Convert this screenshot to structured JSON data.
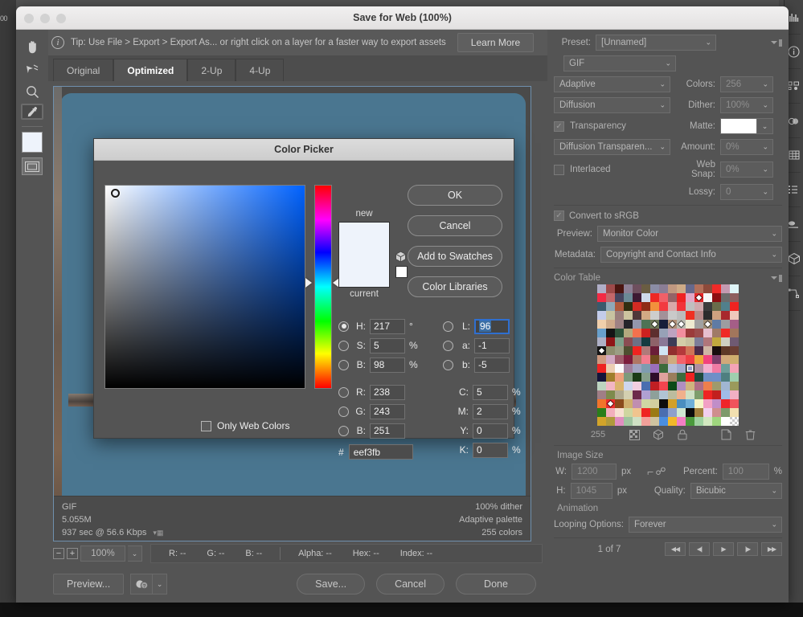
{
  "window": {
    "title": "Save for Web (100%)"
  },
  "tip": {
    "icon": "info-icon",
    "text": "Tip: Use File > Export > Export As...  or right click on a layer for a faster way to export assets",
    "button": "Learn More"
  },
  "tools": [
    {
      "name": "hand-tool",
      "glyph": "✋"
    },
    {
      "name": "slice-select-tool",
      "glyph": "➤"
    },
    {
      "name": "zoom-tool",
      "glyph": "🔍"
    },
    {
      "name": "eyedropper-tool",
      "glyph": "💧"
    }
  ],
  "tabs": [
    {
      "label": "Original",
      "active": false
    },
    {
      "label": "Optimized",
      "active": true
    },
    {
      "label": "2-Up",
      "active": false
    },
    {
      "label": "4-Up",
      "active": false
    }
  ],
  "preview_info": {
    "format": "GIF",
    "size": "5.055M",
    "speed": "937 sec @ 56.6 Kbps",
    "dither": "100% dither",
    "palette": "Adaptive palette",
    "colors": "255 colors"
  },
  "statusbar": {
    "zoom": "100%",
    "r": "R: --",
    "g": "G: --",
    "b": "B: --",
    "alpha": "Alpha: --",
    "hex": "Hex: --",
    "index": "Index: --"
  },
  "actions": {
    "preview": "Preview...",
    "save": "Save...",
    "cancel": "Cancel",
    "done": "Done"
  },
  "settings": {
    "preset_label": "Preset:",
    "preset_value": "[Unnamed]",
    "format_value": "GIF",
    "reduction_value": "Adaptive",
    "colors_label": "Colors:",
    "colors_value": "256",
    "dither_method_value": "Diffusion",
    "dither_label": "Dither:",
    "dither_value": "100%",
    "transparency_label": "Transparency",
    "transparency_checked": true,
    "matte_label": "Matte:",
    "matte_color": "#ffffff",
    "transparency_dither_value": "Diffusion Transparen...",
    "amount_label": "Amount:",
    "amount_value": "0%",
    "interlaced_label": "Interlaced",
    "interlaced_checked": false,
    "websnap_label": "Web Snap:",
    "websnap_value": "0%",
    "lossy_label": "Lossy:",
    "lossy_value": "0",
    "convert_srgb_label": "Convert to sRGB",
    "convert_srgb_checked": true,
    "preview_label": "Preview:",
    "preview_value": "Monitor Color",
    "metadata_label": "Metadata:",
    "metadata_value": "Copyright and Contact Info"
  },
  "color_table": {
    "title": "Color Table",
    "count": "255",
    "tool_icons": [
      "web-shift-icon",
      "web-safe-icon",
      "lock-icon",
      "new-color-icon",
      "delete-icon"
    ],
    "swatches": [
      "#b0aec7",
      "#9e4a4a",
      "#4a1510",
      "#8d7f94",
      "#6e4f5e",
      "#6a5d42",
      "#8b8da6",
      "#8a7d95",
      "#c09880",
      "#ceab87",
      "#66688b",
      "#b2705a",
      "#8d4a3a",
      "#f02a28",
      "#c49ab1",
      "#dff5f8",
      "#f22a44",
      "#c4676a",
      "#46455f",
      "#6b8a96",
      "#3d1a33",
      "#cfdaea",
      "#ee2824",
      "#f06068",
      "#946367",
      "#ef2222",
      "#e0a8c6",
      "#e72426",
      "#f7f7f7",
      "#8d0f12",
      "#6c6c6c",
      "#8e5f5f",
      "#3a5a6c",
      "#8fa9b8",
      "#b05a3c",
      "#312e11",
      "#d42b23",
      "#8e2c16",
      "#f2903c",
      "#f23a40",
      "#d9a8a9",
      "#f2333a",
      "#bfbfbf",
      "#cfa9ad",
      "#3c3c3c",
      "#6a6c4a",
      "#51808c",
      "#f02320",
      "#c3ccea",
      "#c8c4a1",
      "#9a7f7c",
      "#ccc49f",
      "#4f3739",
      "#d2a984",
      "#cdcdcd",
      "#a29199",
      "#c9c9c9",
      "#bcbcbc",
      "#ef2f23",
      "#b78a89",
      "#2c2c2c",
      "#cfa280",
      "#a8282d",
      "#efc8bc",
      "#f0cfab",
      "#cfab8b",
      "#9f8284",
      "#26242a",
      "#9397ad",
      "#4e7355",
      "#6e7859",
      "#171d3a",
      "#b09079",
      "#b9b9b0",
      "#eeead0",
      "#a1a1a1",
      "#a08d74",
      "#5f7ba4",
      "#9d9da0",
      "#a55e87",
      "#68a0cc",
      "#151515",
      "#2e5239",
      "#b3a97e",
      "#f2714e",
      "#cd2120",
      "#5d2e2e",
      "#97a1b7",
      "#bda3c0",
      "#f28e9e",
      "#9b3b3b",
      "#9b4c4c",
      "#e6bfcf",
      "#a07a67",
      "#ef2a26",
      "#a2765c",
      "#aeb0c6",
      "#8f1517",
      "#7e9f89",
      "#8a4c52",
      "#6c7185",
      "#153b40",
      "#8e6269",
      "#8a7896",
      "#3c3c56",
      "#d3cda8",
      "#c8c2a0",
      "#7d7d99",
      "#b0767a",
      "#c2a83e",
      "#cfd0c2",
      "#6f5a72",
      "#161616",
      "#8e8e6e",
      "#9b9e84",
      "#4e4e30",
      "#ef241f",
      "#b07a79",
      "#6a1e38",
      "#cfe5f3",
      "#912e2e",
      "#b5393b",
      "#cf7356",
      "#4c2b48",
      "#cfb5a4",
      "#190d0d",
      "#5e3827",
      "#6b3f33",
      "#cf9a80",
      "#d2aac4",
      "#9f5d6c",
      "#7c1d3c",
      "#b07764",
      "#f27d8e",
      "#6e4a1e",
      "#a87e74",
      "#cfab7e",
      "#f2636b",
      "#ef3f44",
      "#eda83c",
      "#f2437c",
      "#7e3f6c",
      "#d2a87a",
      "#cfae6e",
      "#ee2321",
      "#eccfb3",
      "#fbfbfb",
      "#9f7f9c",
      "#a1a3c0",
      "#7e9cb0",
      "#9a6fbc",
      "#3c6b3c",
      "#b7bdd7",
      "#a3a9cc",
      "#9aa0c8",
      "#b08ea0",
      "#f2b0cf",
      "#f07ba4",
      "#6e9e9a",
      "#f4a3b6",
      "#14143a",
      "#a07e2a",
      "#eda07c",
      "#7e9a7c",
      "#1a3b16",
      "#86a08c",
      "#2e0c2a",
      "#e0a29e",
      "#9a7e5c",
      "#3c6b3e",
      "#ee2322",
      "#1e4a3c",
      "#6f8fc4",
      "#6f8fc8",
      "#4e7f80",
      "#9fcfae",
      "#bcd4c0",
      "#f2b6c4",
      "#dbb46e",
      "#cfd6ee",
      "#f2cfe0",
      "#4a6eb0",
      "#c01f23",
      "#f2444e",
      "#0c4a18",
      "#b08ec0",
      "#cfb47e",
      "#b06e86",
      "#ee7f4c",
      "#9f9a6c",
      "#a0b6d2",
      "#9a9a5c",
      "#a07e86",
      "#7e8a4c",
      "#b0a98e",
      "#d4cfb0",
      "#6c2a4a",
      "#b0a0d2",
      "#8ea09a",
      "#b0c4d4",
      "#bcbc9e",
      "#f0b08c",
      "#cfe0c4",
      "#7e9e6c",
      "#ee2423",
      "#c21f1e",
      "#a0bce8",
      "#f2b0c4",
      "#f2742a",
      "#ed2c2c",
      "#8a4a1c",
      "#cfae6e",
      "#c08eb0",
      "#cfd6a4",
      "#d2cfa0",
      "#0d0d0d",
      "#d2a02a",
      "#4a8ec0",
      "#6fafd8",
      "#f5f5c8",
      "#f2a0c4",
      "#c08ec8",
      "#ee242a",
      "#ef545c",
      "#2a7e1a",
      "#f2b0bc",
      "#f7e0d2",
      "#cfd6a0",
      "#f0c48e",
      "#ef2422",
      "#9a7a14",
      "#4a6eb0",
      "#8ea0cc",
      "#cfe8d2",
      "#0c0c0c",
      "#a07e3c",
      "#f2cfee",
      "#cf8e8e",
      "#7e9a6c",
      "#f2e0b0",
      "#d2a42a",
      "#b09a3c",
      "#e08ec0",
      "#a0c4a0",
      "#cfe0c4",
      "#f2a09a",
      "#cfc4a0",
      "#4a8ee0",
      "#f2b82a",
      "#f27fc4",
      "#4a9a3c",
      "#9fd2a0",
      "#d2e8c0",
      "#9fd67e",
      "#ffffff",
      "#4e4a4a"
    ]
  },
  "image_size": {
    "title": "Image Size",
    "w_label": "W:",
    "w_value": "1200",
    "w_unit": "px",
    "h_label": "H:",
    "h_value": "1045",
    "h_unit": "px",
    "percent_label": "Percent:",
    "percent_value": "100",
    "percent_unit": "%",
    "quality_label": "Quality:",
    "quality_value": "Bicubic"
  },
  "animation": {
    "title": "Animation",
    "looping_label": "Looping Options:",
    "looping_value": "Forever",
    "frame_counter": "1 of 7",
    "nav": [
      "◀◀",
      "◀|",
      "▶",
      "|▶",
      "▶▶"
    ]
  },
  "color_picker": {
    "title": "Color Picker",
    "new_label": "new",
    "current_label": "current",
    "new_color": "#eef3fb",
    "current_color": "#eef3fb",
    "web_swatch_color": "#ffffff",
    "buttons": [
      "OK",
      "Cancel",
      "Add to Swatches",
      "Color Libraries"
    ],
    "only_web_colors_label": "Only Web Colors",
    "only_web_colors_checked": false,
    "hex_prefix": "#",
    "hex_value": "eef3fb",
    "hsb": [
      {
        "key": "H:",
        "value": "217",
        "unit": "°",
        "selected": true
      },
      {
        "key": "S:",
        "value": "5",
        "unit": "%",
        "selected": false
      },
      {
        "key": "B:",
        "value": "98",
        "unit": "%",
        "selected": false
      }
    ],
    "lab": [
      {
        "key": "L:",
        "value": "96",
        "unit": "",
        "selected": false,
        "focused": true
      },
      {
        "key": "a:",
        "value": "-1",
        "unit": "",
        "selected": false
      },
      {
        "key": "b:",
        "value": "-5",
        "unit": "",
        "selected": false
      }
    ],
    "rgb": [
      {
        "key": "R:",
        "value": "238",
        "selected": false
      },
      {
        "key": "G:",
        "value": "243",
        "selected": false
      },
      {
        "key": "B:",
        "value": "251",
        "selected": false
      }
    ],
    "cmyk": [
      {
        "key": "C:",
        "value": "5",
        "unit": "%"
      },
      {
        "key": "M:",
        "value": "2",
        "unit": "%"
      },
      {
        "key": "Y:",
        "value": "0",
        "unit": "%"
      },
      {
        "key": "K:",
        "value": "0",
        "unit": "%"
      }
    ]
  },
  "desktop": {
    "left_edge_label": "00"
  }
}
